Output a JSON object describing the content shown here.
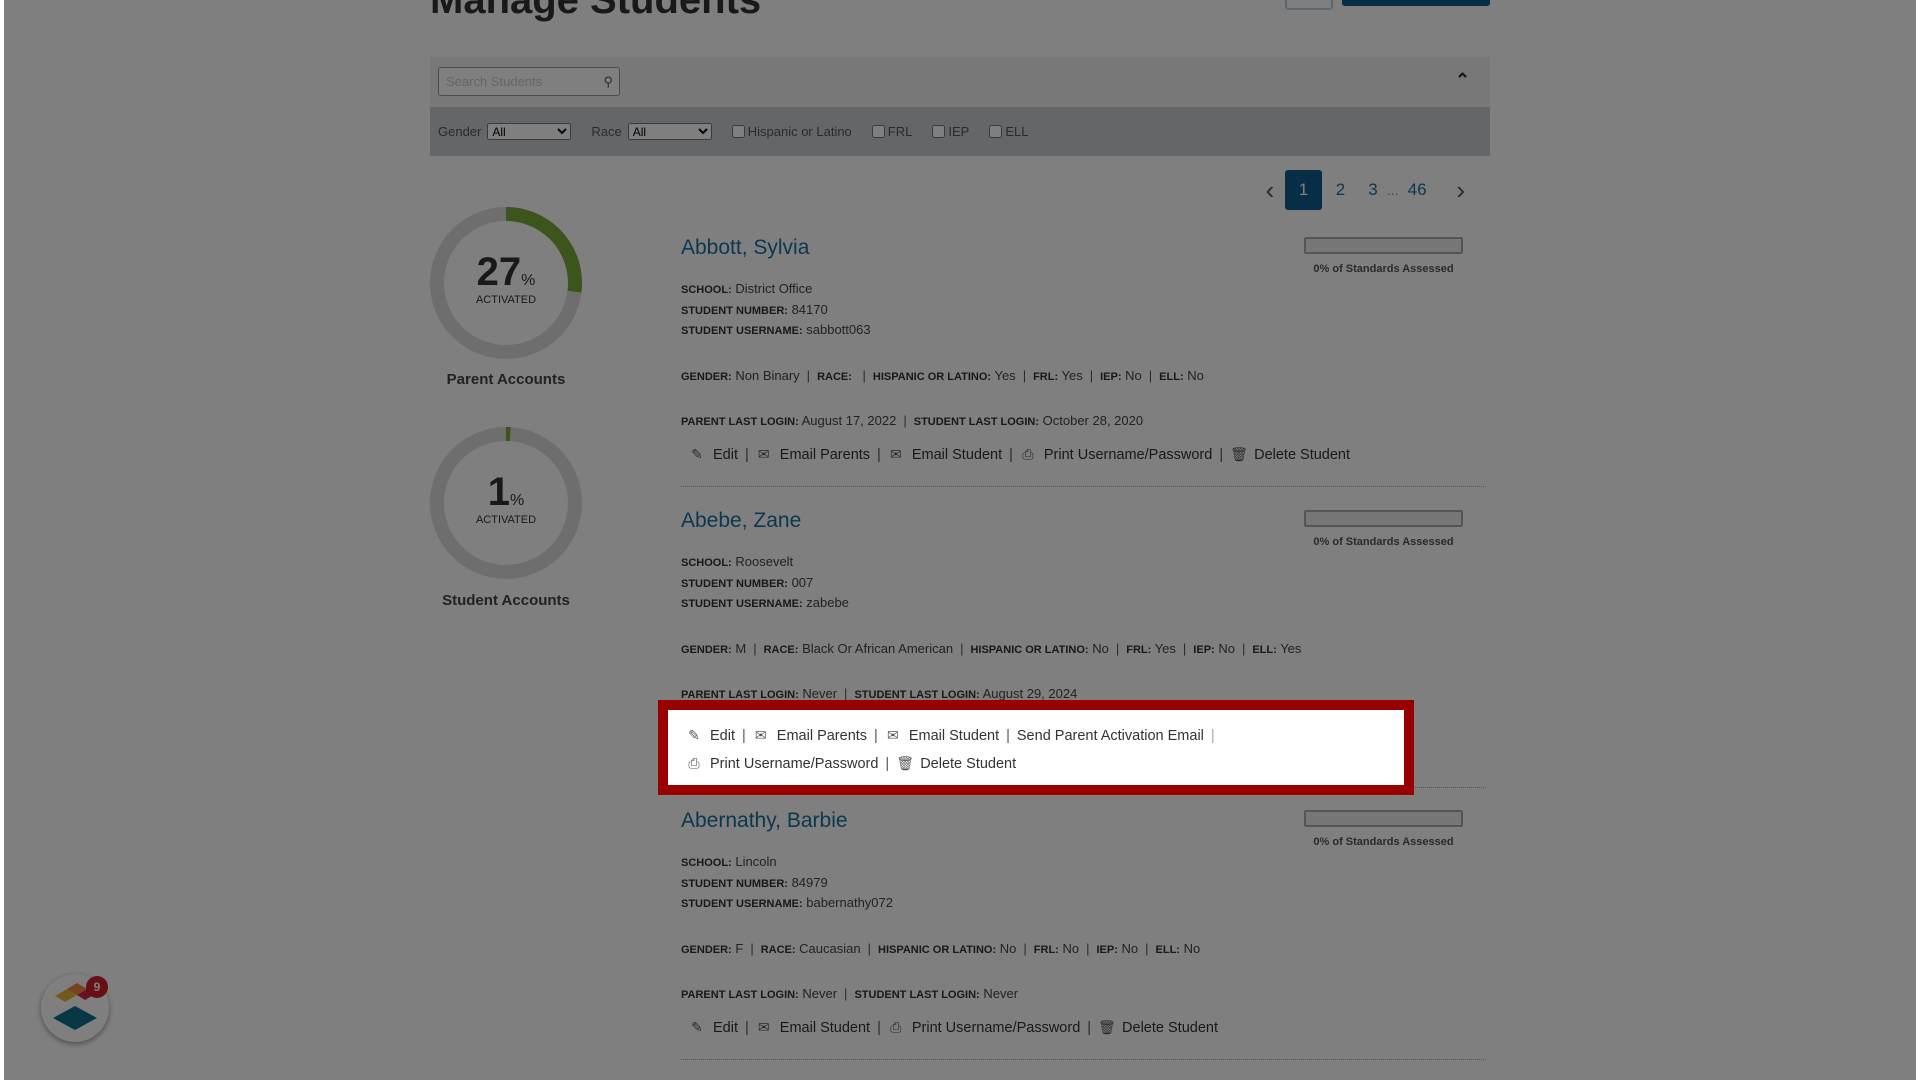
{
  "page": {
    "title": "Manage Students"
  },
  "search": {
    "placeholder": "Search Students"
  },
  "filters": {
    "gender_label": "Gender",
    "gender_value": "All",
    "race_label": "Race",
    "race_value": "All",
    "checkboxes": [
      "Hispanic or Latino",
      "FRL",
      "IEP",
      "ELL"
    ]
  },
  "pagination": {
    "pages": [
      "1",
      "2",
      "3"
    ],
    "ellipsis": "...",
    "last": "46",
    "current": "1"
  },
  "stats": [
    {
      "value": "27",
      "unit": "%",
      "sublabel": "ACTIVATED",
      "label": "Parent Accounts",
      "percent": 27
    },
    {
      "value": "1",
      "unit": "%",
      "sublabel": "ACTIVATED",
      "label": "Student Accounts",
      "percent": 1
    }
  ],
  "labels": {
    "school": "SCHOOL:",
    "student_number": "STUDENT NUMBER:",
    "student_username": "STUDENT USERNAME:",
    "gender": "GENDER:",
    "race": "RACE:",
    "hispanic": "HISPANIC OR LATINO:",
    "frl": "FRL:",
    "iep": "IEP:",
    "ell": "ELL:",
    "parent_last_login": "PARENT LAST LOGIN:",
    "student_last_login": "STUDENT LAST LOGIN:",
    "standards": "0% of Standards Assessed"
  },
  "actions": {
    "edit": "Edit",
    "email_parents": "Email Parents",
    "email_student": "Email Student",
    "send_activation": "Send Parent Activation Email",
    "print": "Print Username/Password",
    "delete": "Delete Student"
  },
  "students": [
    {
      "name": "Abbott, Sylvia",
      "school": "District Office",
      "number": "84170",
      "username": "sabbott063",
      "gender": "Non Binary",
      "race": "",
      "hispanic": "Yes",
      "frl": "Yes",
      "iep": "No",
      "ell": "No",
      "parent_login": "August 17, 2022",
      "student_login": "October 28, 2020",
      "standards_percent": 0
    },
    {
      "name": "Abebe, Zane",
      "school": "Roosevelt",
      "number": "007",
      "username": "zabebe",
      "gender": "M",
      "race": "Black Or African American",
      "hispanic": "No",
      "frl": "Yes",
      "iep": "No",
      "ell": "Yes",
      "parent_login": "Never",
      "student_login": "August 29, 2024",
      "standards_percent": 0
    },
    {
      "name": "Abernathy, Barbie",
      "school": "Lincoln",
      "number": "84979",
      "username": "babernathy072",
      "gender": "F",
      "race": "Caucasian",
      "hispanic": "No",
      "frl": "No",
      "iep": "No",
      "ell": "No",
      "parent_login": "Never",
      "student_login": "Never",
      "standards_percent": 0
    }
  ],
  "notification": {
    "count": "9"
  },
  "colors": {
    "accent": "#0f5c8c",
    "progress_green": "#7aa83a",
    "highlight": "#990000",
    "link": "#1a6fa3"
  }
}
